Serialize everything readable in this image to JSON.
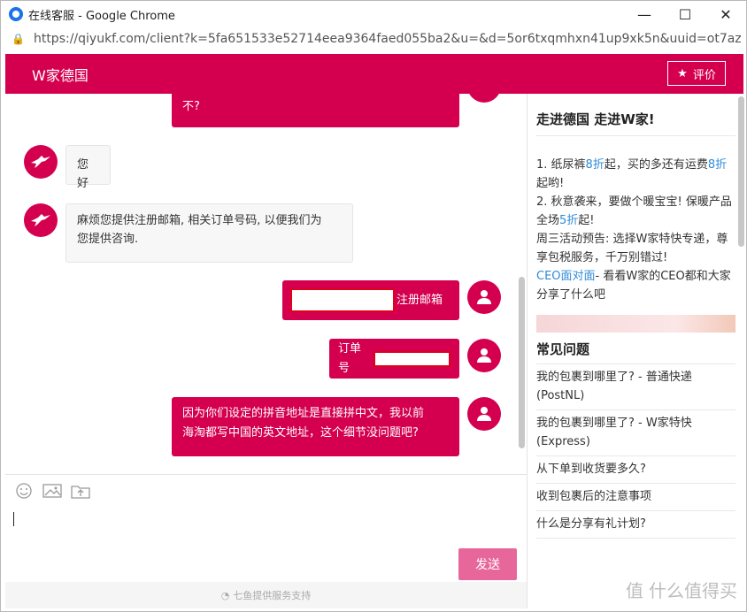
{
  "window": {
    "title": "在线客服 - Google Chrome",
    "url": "https://qiyukf.com/client?k=5fa651533e52714eea9364faed055ba2&u=&d=5or6txqmhxn41up9xk5n&uuid=ot7azm..."
  },
  "header": {
    "brand": "W家德国",
    "rate_label": "评价"
  },
  "messages": {
    "top_right_partial": "不?",
    "agent_1": "您好",
    "agent_2_line1": "麻烦您提供注册邮箱, 相关订单号码, 以便我们为",
    "agent_2_line2": "您提供咨询.",
    "user_1_suffix": "注册邮箱",
    "user_2_prefix": "订单号",
    "user_3_line1": "因为你们设定的拼音地址是直接拼中文，我以前",
    "user_3_line2": "海淘都写中国的英文地址，这个细节没问题吧?"
  },
  "composer": {
    "send_label": "发送",
    "footer": "七鱼提供服务支持"
  },
  "sidebar": {
    "promo_title": "走进德国 走进W家!",
    "promo": {
      "l1a": "1. 纸尿裤",
      "l1b": "8折",
      "l1c": "起，买的多还有运费",
      "l1d": "8折",
      "l1e": "起哟!",
      "l2a": "2. 秋意袭来，要做个暖宝宝! 保暖产品全场",
      "l2b": "5折",
      "l2c": "起!",
      "l3": "周三活动预告: 选择W家特快专递，尊享包税服务，千万别错过!",
      "l4a": "CEO面对面",
      "l4b": "- 看看W家的CEO都和大家分享了什么吧"
    },
    "faq_title": "常见问题",
    "faqs": [
      "我的包裹到哪里了? - 普通快递 (PostNL)",
      "我的包裹到哪里了? - W家特快 (Express)",
      "从下单到收货要多久?",
      "收到包裹后的注意事项",
      "什么是分享有礼计划?"
    ]
  },
  "watermark": "什么值得买"
}
